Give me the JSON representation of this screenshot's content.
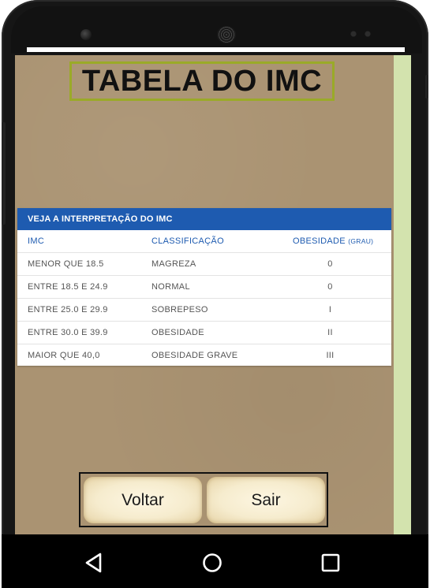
{
  "screen": {
    "title": "TABELA DO IMC",
    "table": {
      "header": "VEJA A INTERPRETAÇÃO DO IMC",
      "columns": {
        "imc": "IMC",
        "classificacao": "CLASSIFICAÇÃO",
        "obesidade": "OBESIDADE",
        "obesidade_suffix": "(GRAU)"
      },
      "rows": [
        {
          "imc": "MENOR QUE 18.5",
          "classificacao": "MAGREZA",
          "grau": "0"
        },
        {
          "imc": "ENTRE 18.5 E 24.9",
          "classificacao": "NORMAL",
          "grau": "0"
        },
        {
          "imc": "ENTRE 25.0 E 29.9",
          "classificacao": "SOBREPESO",
          "grau": "I"
        },
        {
          "imc": "ENTRE 30.0 E 39.9",
          "classificacao": "OBESIDADE",
          "grau": "II"
        },
        {
          "imc": "MAIOR QUE 40,0",
          "classificacao": "OBESIDADE GRAVE",
          "grau": "III"
        }
      ]
    },
    "buttons": {
      "voltar": "Voltar",
      "sair": "Sair"
    }
  },
  "navbar": {
    "back_icon": "triangle-back-icon",
    "home_icon": "circle-home-icon",
    "recents_icon": "square-recents-icon"
  },
  "colors": {
    "screen_background": "#aa9372",
    "side_strip": "#d3e3ae",
    "title_border": "#9aaa28",
    "table_header": "#1e5bb0",
    "button_face": "#f6ecce"
  }
}
